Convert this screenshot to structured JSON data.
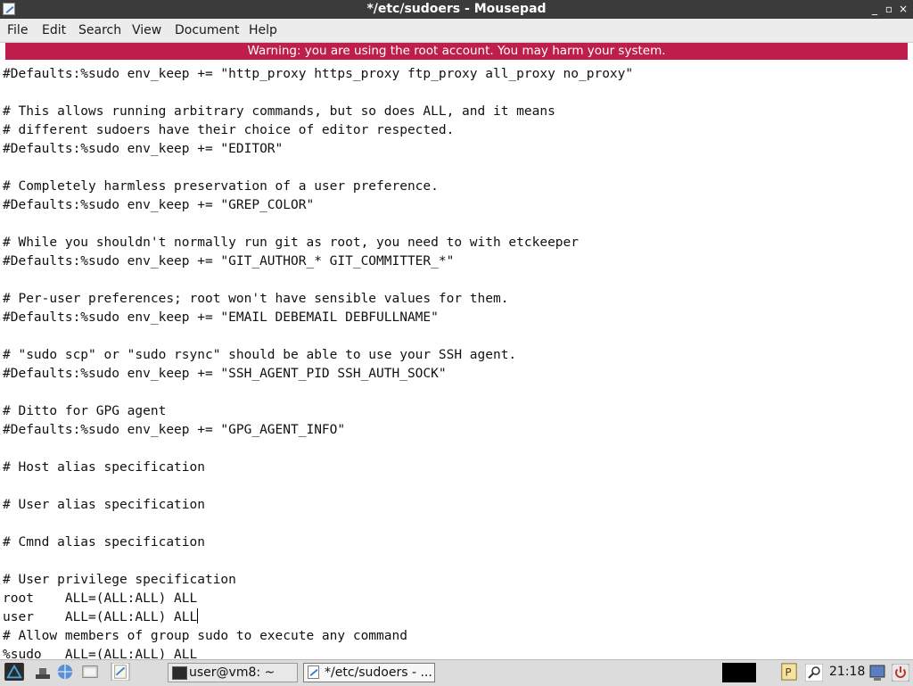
{
  "window": {
    "title": "*/etc/sudoers - Mousepad"
  },
  "menu": [
    "File",
    "Edit",
    "Search",
    "View",
    "Document",
    "Help"
  ],
  "warning": "Warning: you are using the root account. You may harm your system.",
  "editor": {
    "lines": [
      "#Defaults:%sudo env_keep += \"http_proxy https_proxy ftp_proxy all_proxy no_proxy\"",
      "",
      "# This allows running arbitrary commands, but so does ALL, and it means",
      "# different sudoers have their choice of editor respected.",
      "#Defaults:%sudo env_keep += \"EDITOR\"",
      "",
      "# Completely harmless preservation of a user preference.",
      "#Defaults:%sudo env_keep += \"GREP_COLOR\"",
      "",
      "# While you shouldn't normally run git as root, you need to with etckeeper",
      "#Defaults:%sudo env_keep += \"GIT_AUTHOR_* GIT_COMMITTER_*\"",
      "",
      "# Per-user preferences; root won't have sensible values for them.",
      "#Defaults:%sudo env_keep += \"EMAIL DEBEMAIL DEBFULLNAME\"",
      "",
      "# \"sudo scp\" or \"sudo rsync\" should be able to use your SSH agent.",
      "#Defaults:%sudo env_keep += \"SSH_AGENT_PID SSH_AUTH_SOCK\"",
      "",
      "# Ditto for GPG agent",
      "#Defaults:%sudo env_keep += \"GPG_AGENT_INFO\"",
      "",
      "# Host alias specification",
      "",
      "# User alias specification",
      "",
      "# Cmnd alias specification",
      "",
      "# User privilege specification",
      "root    ALL=(ALL:ALL) ALL",
      "user    ALL=(ALL:ALL) ALL",
      "# Allow members of group sudo to execute any command",
      "%sudo   ALL=(ALL:ALL) ALL"
    ],
    "cursor_line": 29
  },
  "taskbar": {
    "tasks": [
      {
        "label": "user@vm8: ~",
        "icon": "terminal-icon"
      },
      {
        "label": "*/etc/sudoers - ...",
        "icon": "text-editor-icon"
      }
    ],
    "clock": "21:18"
  }
}
